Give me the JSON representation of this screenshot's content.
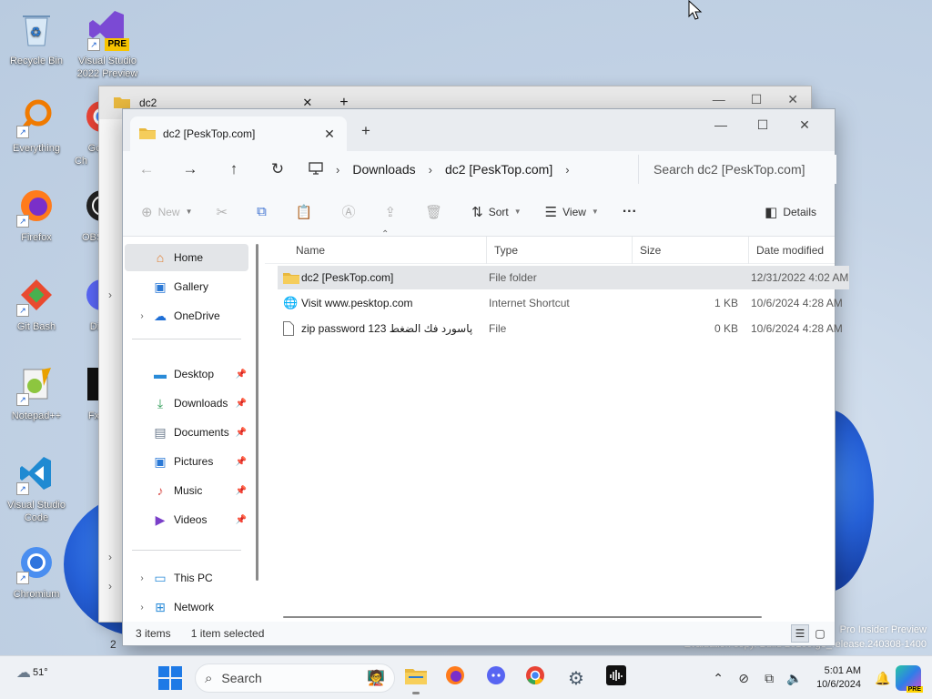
{
  "desktop": {
    "icons_left": [
      {
        "label": "Recycle Bin",
        "icon": "recycle-bin-icon"
      },
      {
        "label": "Everything",
        "icon": "everything-search-icon"
      },
      {
        "label": "Firefox",
        "icon": "firefox-icon"
      },
      {
        "label": "Git Bash",
        "icon": "git-bash-icon"
      },
      {
        "label": "Notepad++",
        "icon": "notepad-plus-plus-icon"
      },
      {
        "label": "Visual Studio Code",
        "icon": "vscode-icon"
      },
      {
        "label": "Chromium",
        "icon": "chromium-icon"
      }
    ],
    "icons_second": [
      {
        "label": "Visual Studio 2022 Preview",
        "badge": "PRE",
        "icon": "visual-studio-icon"
      },
      {
        "label": "Go Ch",
        "icon": "chrome-icon"
      },
      {
        "label": "OBS",
        "icon": "obs-icon"
      },
      {
        "label": "Di",
        "icon": "discord-icon"
      },
      {
        "label": "Fx",
        "icon": "fx-icon"
      }
    ],
    "watermark_line1": "Pro Insider Preview",
    "watermark_line2": "Evaluation copy. Build 26100.ge_release.240308-1400"
  },
  "back_window": {
    "tab_title": "dc2"
  },
  "explorer": {
    "tab_title": "dc2 [PeskTop.com]",
    "new_tab": "+",
    "breadcrumbs": [
      "Downloads",
      "dc2 [PeskTop.com]"
    ],
    "search_placeholder": "Search dc2 [PeskTop.com]",
    "toolbar": {
      "new_label": "New",
      "sort_label": "Sort",
      "view_label": "View",
      "more_label": "···",
      "details_label": "Details"
    },
    "nav": {
      "home": "Home",
      "gallery": "Gallery",
      "onedrive": "OneDrive",
      "desktop": "Desktop",
      "downloads": "Downloads",
      "documents": "Documents",
      "pictures": "Pictures",
      "music": "Music",
      "videos": "Videos",
      "this_pc": "This PC",
      "network": "Network"
    },
    "columns": {
      "name": "Name",
      "type": "Type",
      "size": "Size",
      "date": "Date modified"
    },
    "files": [
      {
        "name": "dc2 [PeskTop.com]",
        "type": "File folder",
        "size": "",
        "date": "12/31/2022 4:02 AM",
        "icon": "folder-icon"
      },
      {
        "name": "Visit www.pesktop.com",
        "type": "Internet Shortcut",
        "size": "1 KB",
        "date": "10/6/2024 4:28 AM",
        "icon": "internet-shortcut-icon"
      },
      {
        "name": "zip password 123 پاسورد فك الضغط",
        "type": "File",
        "size": "0 KB",
        "date": "10/6/2024 4:28 AM",
        "icon": "file-icon"
      }
    ],
    "status": {
      "items": "3 items",
      "selected": "1 item selected"
    }
  },
  "taskbar": {
    "weather_temp": "51°",
    "search_label": "Search",
    "clock_time": "5:01 AM",
    "clock_date": "10/6/2024"
  }
}
